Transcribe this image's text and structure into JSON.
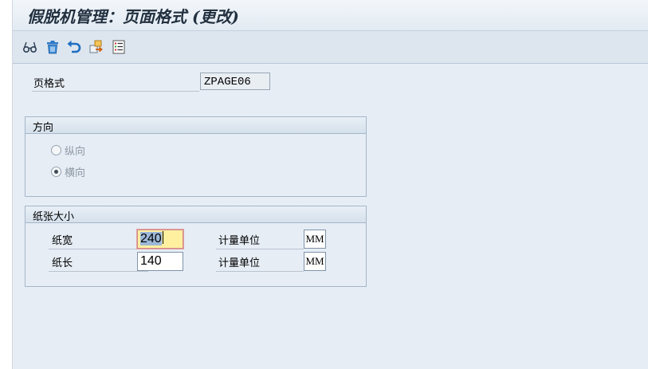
{
  "window": {
    "title": "假脱机管理：页面格式 (更改)"
  },
  "toolbar": {
    "buttons": [
      {
        "icon": "glasses-icon",
        "label": "显示/更改"
      },
      {
        "icon": "trash-icon",
        "label": "删除"
      },
      {
        "icon": "undo-icon",
        "label": "撤销"
      },
      {
        "icon": "transport-icon",
        "label": "传输"
      },
      {
        "icon": "document-list-icon",
        "label": "文档"
      }
    ]
  },
  "header_field": {
    "label": "页格式",
    "value": "ZPAGE06"
  },
  "orientation": {
    "title": "方向",
    "options": [
      {
        "label": "纵向",
        "selected": false
      },
      {
        "label": "横向",
        "selected": true
      }
    ]
  },
  "paper_size": {
    "title": "纸张大小",
    "width": {
      "label": "纸宽",
      "value": "240",
      "unit_label": "计量单位",
      "unit": "MM"
    },
    "length": {
      "label": "纸长",
      "value": "140",
      "unit_label": "计量单位",
      "unit": "MM"
    }
  }
}
